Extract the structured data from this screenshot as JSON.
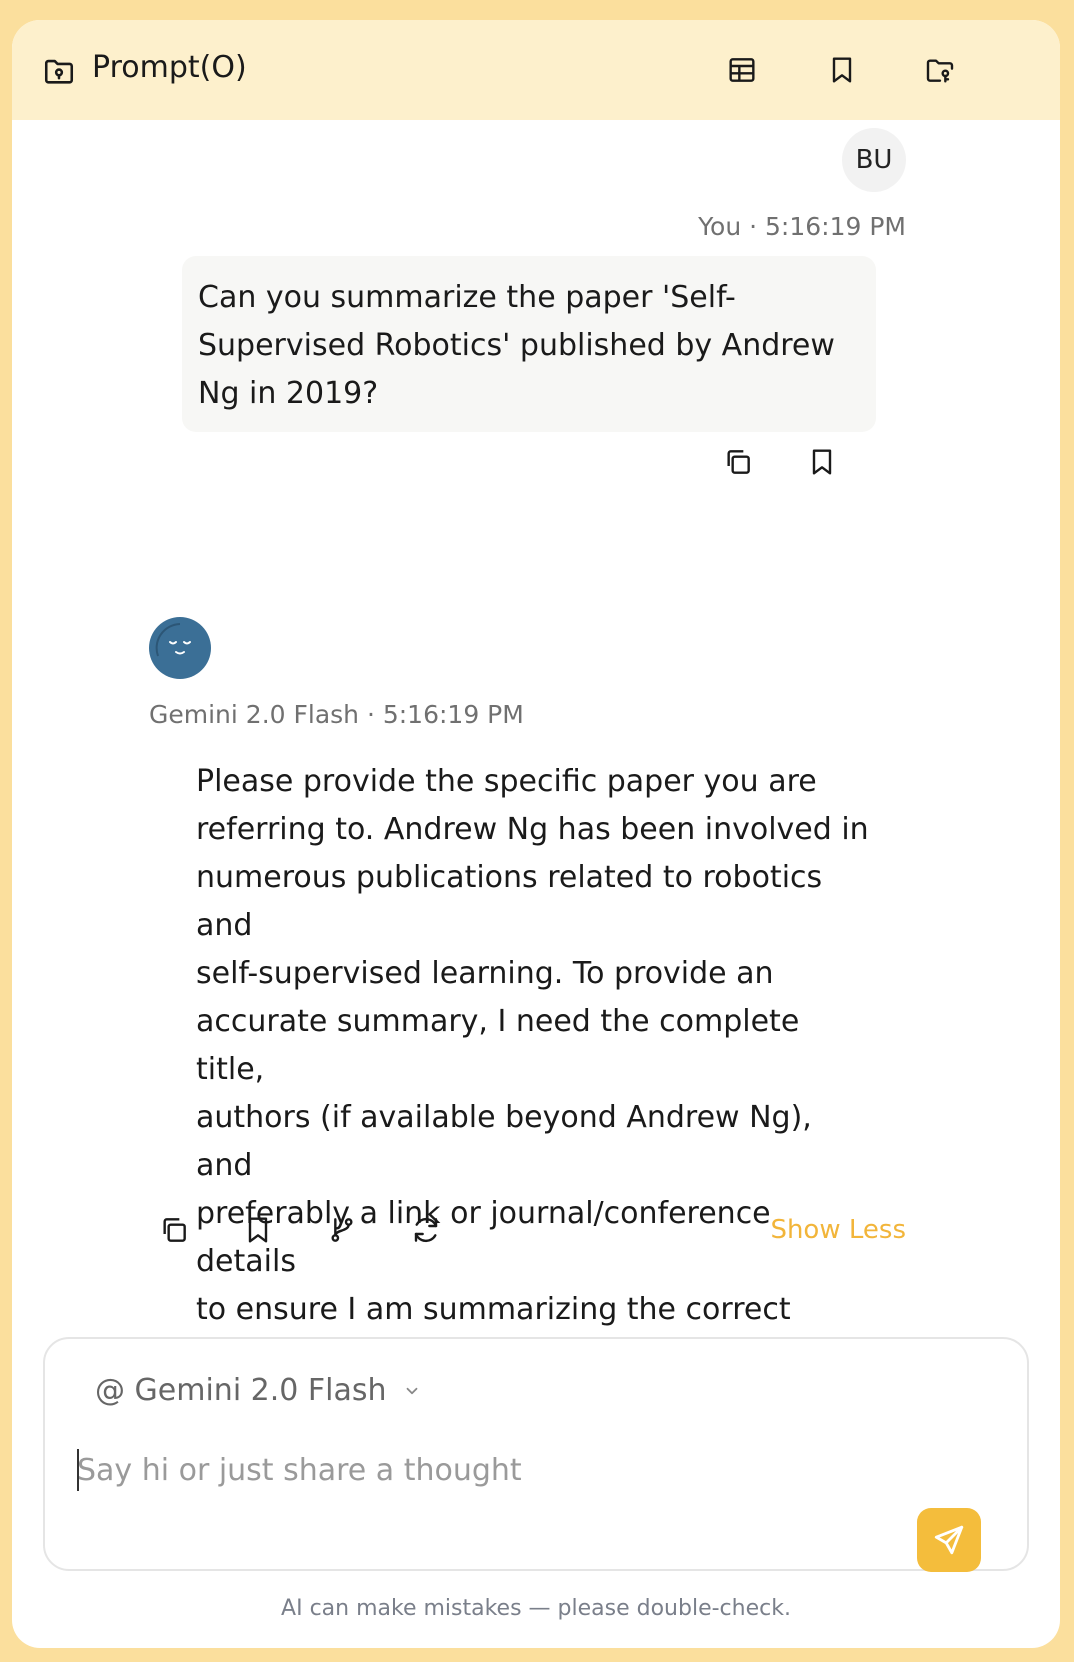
{
  "header": {
    "title": "Prompt(O)"
  },
  "user_message": {
    "avatar_initials": "BU",
    "meta": "You · 5:16:19 PM",
    "lines": [
      "Can you summarize the paper 'Self-",
      "Supervised Robotics' published by Andrew",
      "Ng in 2019?"
    ]
  },
  "ai_message": {
    "meta": "Gemini 2.0 Flash · 5:16:19 PM",
    "lines": [
      "Please provide the specific paper you are",
      "referring to. Andrew Ng has been involved in",
      "numerous publications related to robotics and",
      "self-supervised learning. To provide an",
      "accurate summary, I need the complete title,",
      "authors (if available beyond Andrew Ng), and",
      "preferably a link or journal/conference details",
      "to ensure I am summarizing the correct paper."
    ],
    "show_less_label": "Show Less"
  },
  "composer": {
    "model_label": "@ Gemini 2.0 Flash",
    "placeholder": "Say hi or just share a thought",
    "value": ""
  },
  "footer": {
    "disclaimer": "AI can make mistakes — please double-check."
  },
  "colors": {
    "background": "#fbdf9d",
    "header_bg": "#fdf0cc",
    "accent": "#f4bd3c",
    "ai_avatar": "#3b6f96"
  }
}
